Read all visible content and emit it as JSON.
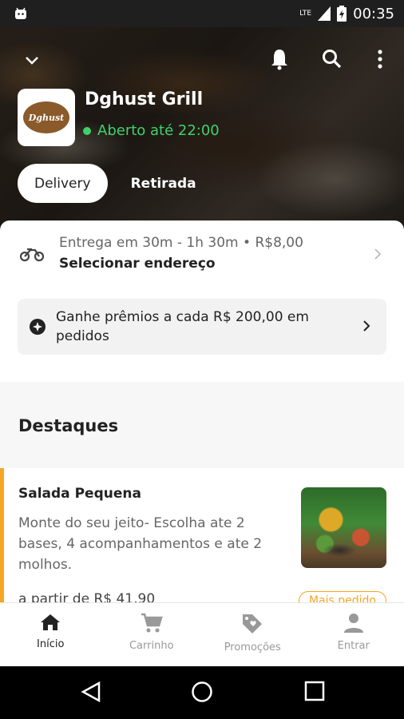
{
  "status_bar": {
    "network": "LTE",
    "time": "00:35"
  },
  "header": {
    "store_name": "Dghust Grill",
    "store_status": "Aberto até 22:00",
    "logo_text": "Dghust"
  },
  "mode": {
    "delivery": "Delivery",
    "pickup": "Retirada"
  },
  "delivery": {
    "info": "Entrega em 30m - 1h 30m • R$8,00",
    "address_action": "Selecionar endereço"
  },
  "reward": {
    "text": "Ganhe prêmios a cada R$ 200,00 em pedidos"
  },
  "highlights": {
    "title": "Destaques",
    "product": {
      "name": "Salada Pequena",
      "description": "Monte do seu jeito- Escolha  ate 2 bases, 4 acompanhamentos e ate 2 molhos.",
      "price": "a partir de R$ 41,90",
      "badge": "Mais pedido"
    }
  },
  "bottom_nav": [
    {
      "label": "Início",
      "icon": "home-icon"
    },
    {
      "label": "Carrinho",
      "icon": "cart-icon"
    },
    {
      "label": "Promoções",
      "icon": "tag-heart-icon"
    },
    {
      "label": "Entrar",
      "icon": "person-icon"
    }
  ],
  "colors": {
    "accent": "#f6a623",
    "open_green": "#3fd26b"
  }
}
